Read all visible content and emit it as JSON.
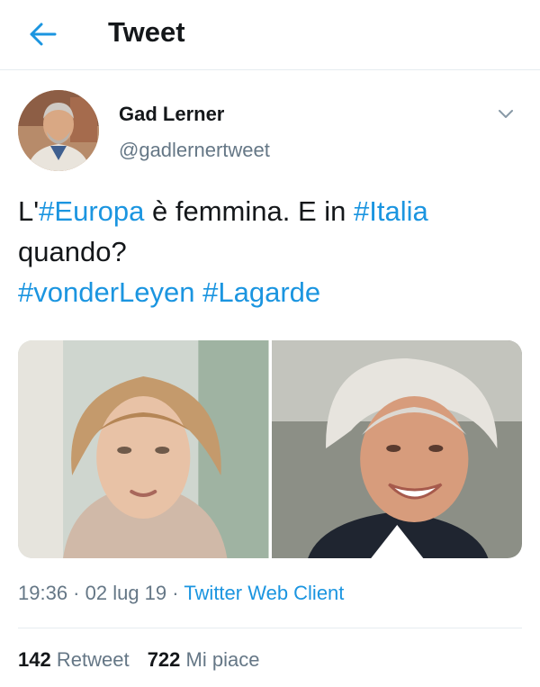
{
  "header": {
    "back_icon": "arrow-left-icon",
    "title": "Tweet"
  },
  "author": {
    "name": "Gad Lerner",
    "handle": "@gadlernertweet",
    "menu_icon": "chevron-down-icon"
  },
  "tweet": {
    "t1": "L'",
    "tag_europa": "#Europa",
    "t2": " è femmina. E in ",
    "tag_italia": "#Italia",
    "t3": "quando?",
    "tag_vonderleyen": "#vonderLeyen",
    "tag_lagarde": "#Lagarde"
  },
  "meta": {
    "time": "19:36",
    "sep1": " · ",
    "date": "02 lug 19",
    "sep2": " · ",
    "client": "Twitter Web Client"
  },
  "stats": {
    "retweets": "142",
    "retweets_label": "Retweet",
    "likes": "722",
    "likes_label": "Mi piace"
  },
  "colors": {
    "accent": "#1b95e0",
    "secondary_text": "#657786",
    "primary_text": "#14171a"
  }
}
